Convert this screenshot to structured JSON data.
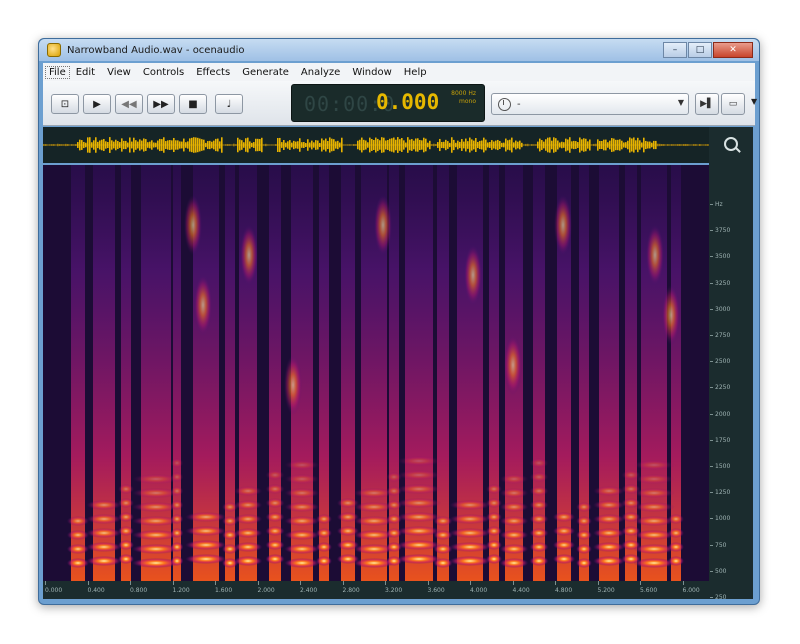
{
  "window": {
    "title": "Narrowband Audio.wav - ocenaudio"
  },
  "menu": [
    "File",
    "Edit",
    "View",
    "Controls",
    "Effects",
    "Generate",
    "Analyze",
    "Window",
    "Help"
  ],
  "transport": {
    "time": "0.000",
    "time_ghost": "00:00:0",
    "sample_rate": "8000 Hz",
    "channels": "mono"
  },
  "preset": {
    "value": "-"
  },
  "spectrogram": {
    "y_axis_labels": [
      "Hz",
      "3750",
      "3500",
      "3250",
      "3000",
      "2750",
      "2500",
      "2250",
      "2000",
      "1750",
      "1500",
      "1250",
      "1000",
      "750",
      "500",
      "250"
    ],
    "x_axis_labels": [
      "0.000",
      "0.400",
      "0.800",
      "1.200",
      "1.600",
      "2.000",
      "2.400",
      "2.800",
      "3.200",
      "3.600",
      "4.000",
      "4.400",
      "4.800",
      "5.200",
      "5.600",
      "6.000"
    ]
  },
  "colors": {
    "titlebar": "#9fc0e5",
    "lcd_text": "#e6b800",
    "panel": "#1b2c2e",
    "spectro_bg": "#1c0c35"
  }
}
